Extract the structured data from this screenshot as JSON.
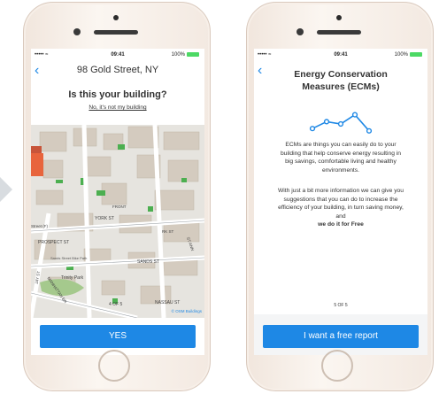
{
  "status": {
    "carrier": "••••• ≈",
    "time": "09:41",
    "battery": "100%"
  },
  "screen1": {
    "address": "98 Gold Street, NY",
    "question": "Is this your building?",
    "not_my_building": "No, it's not my building",
    "map_labels": [
      "YORK ST",
      "SANDS ST",
      "NASSAU ST",
      "Trinity Park",
      "PROSPECT ST",
      "Sands Street Bike Path",
      "MANHATTAN BR",
      "JAY ST",
      "4 OF 5",
      "© OSM Buildings",
      "Street (F)",
      "FRONT",
      "RK ST",
      "ST ANN"
    ],
    "yes_label": "YES"
  },
  "screen2": {
    "title_line1": "Energy Conservation",
    "title_line2": "Measures (ECMs)",
    "graph_values": [
      0.3,
      0.6,
      0.5,
      0.9,
      0.2
    ],
    "desc1_lines": [
      "ECMs are things you can easily do to your",
      "building that help conserve energy resulting in",
      "big savings, comfortable living and healthy",
      "environments."
    ],
    "desc2_lines": [
      "With just a bit more information we can give you",
      "suggestions that you can do to increase the",
      "efficiency of your building, in turn saving money,",
      "and"
    ],
    "desc2_strong": "we do it for Free",
    "pager": "5 OF 5",
    "report_label": "I want a free report"
  },
  "colors": {
    "accent": "#1e88e5",
    "battery": "#4cd964",
    "building_highlight": "#4caf50",
    "building_accent": "#e8643c"
  }
}
